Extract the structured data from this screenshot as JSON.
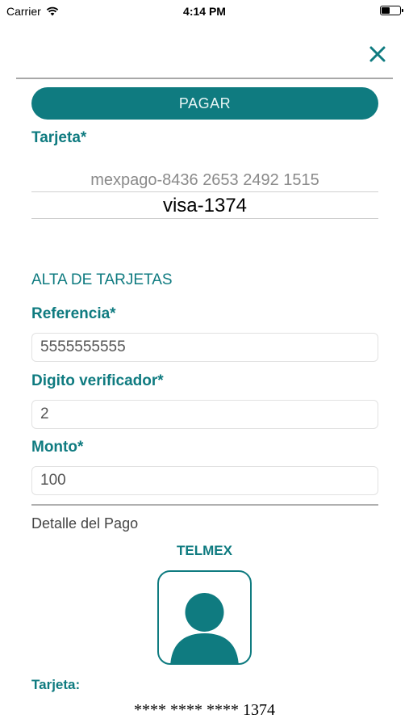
{
  "status_bar": {
    "carrier": "Carrier",
    "time": "4:14 PM"
  },
  "header": {
    "close_icon": "close-icon"
  },
  "pay_button": {
    "label": "PAGAR"
  },
  "card_section": {
    "label": "Tarjeta*",
    "options": [
      "mexpago-8436 2653 2492 1515",
      "visa-1374"
    ],
    "selected": "visa-1374"
  },
  "add_cards": {
    "title": "ALTA DE TARJETAS",
    "reference": {
      "label": "Referencia*",
      "value": "5555555555"
    },
    "check_digit": {
      "label": "Digito verificador*",
      "value": "2"
    },
    "amount": {
      "label": "Monto*",
      "value": "100"
    }
  },
  "payment_detail": {
    "title": "Detalle del Pago",
    "company": "TELMEX",
    "avatar_icon": "user-avatar-icon",
    "card_label": "Tarjeta:",
    "card_number": "**** **** **** 1374"
  },
  "colors": {
    "accent": "#0f7b80",
    "divider": "#a8a8a8"
  }
}
